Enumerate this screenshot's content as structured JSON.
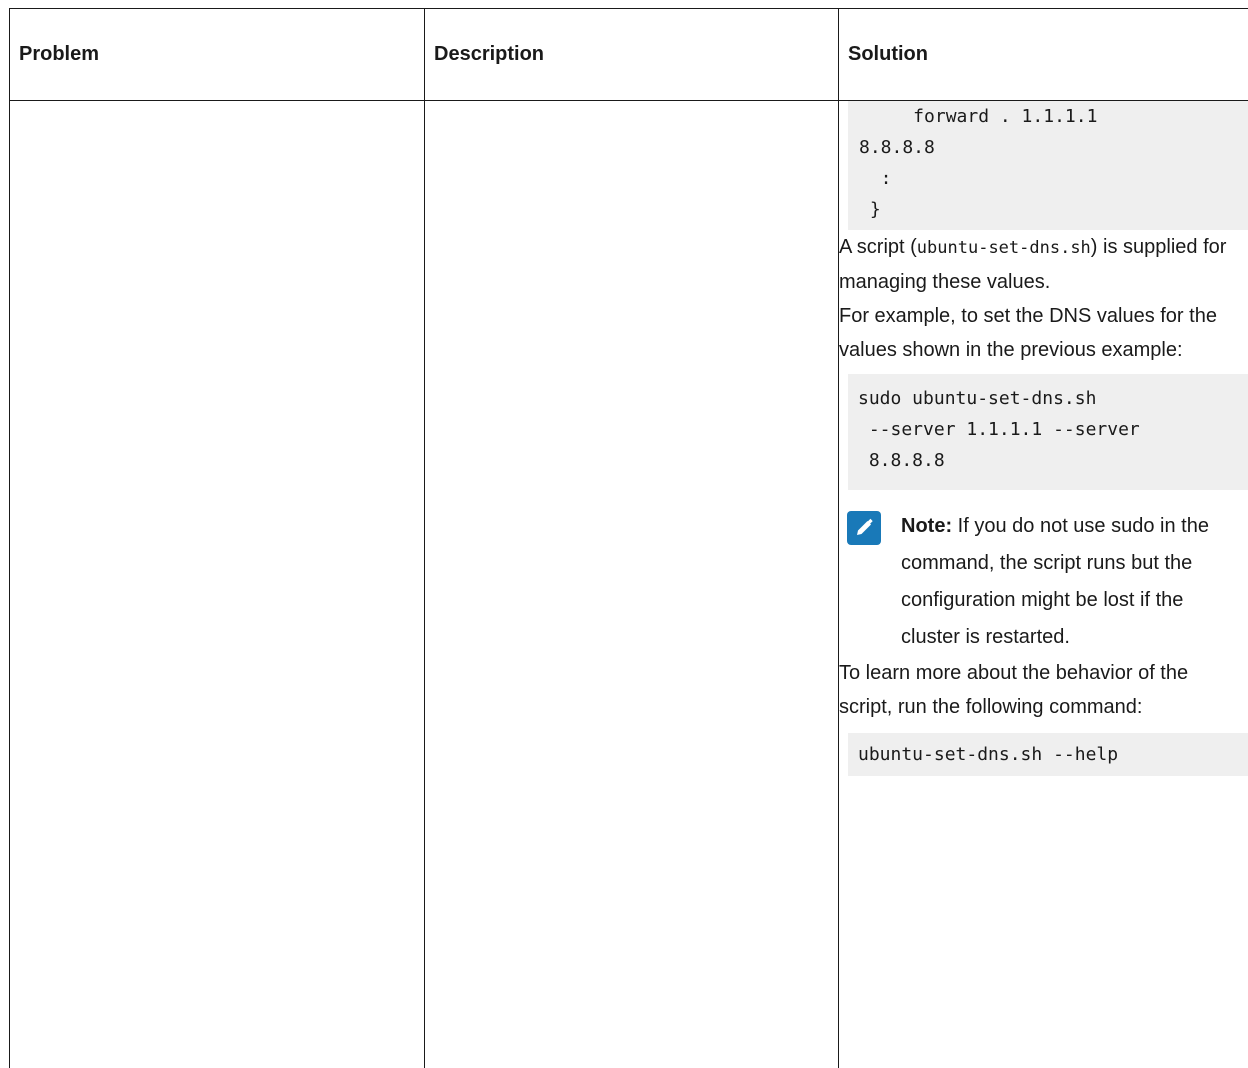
{
  "table": {
    "headers": {
      "problem": "Problem",
      "description": "Description",
      "solution": "Solution"
    }
  },
  "solution": {
    "code_top": "     forward . 1.1.1.1\n8.8.8.8\n  :\n }",
    "para_script_prefix": "A script (",
    "para_script_code": "ubuntu-set-dns.sh",
    "para_script_suffix": ") is supplied for managing these values.",
    "para_example": "For example, to set the DNS values for the values shown in the previous example:",
    "code_mid": "sudo ubuntu-set-dns.sh\n --server 1.1.1.1 --server\n 8.8.8.8",
    "note_label": "Note:",
    "note_text": " If you do not use sudo in the command, the script runs but the configuration might be lost if the cluster is restarted.",
    "para_learn": "To learn more about the behavior of the script, run the following com­mand:",
    "code_bottom": "ubuntu-set-dns.sh --help"
  },
  "icons": {
    "note_icon": "pencil-note-icon",
    "note_color": "#1979b8"
  }
}
